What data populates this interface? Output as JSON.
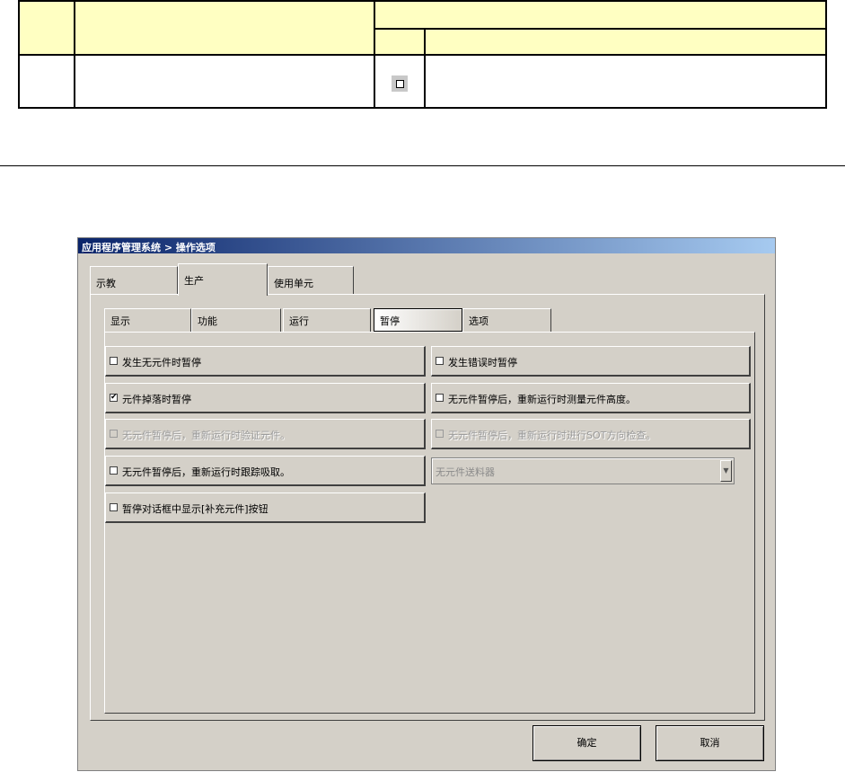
{
  "dialog": {
    "title": "应用程序管理系统 > 操作选项",
    "outer_tabs": [
      {
        "label": "示教",
        "active": false
      },
      {
        "label": "生产",
        "active": true
      },
      {
        "label": "使用单元",
        "active": false
      }
    ],
    "inner_tabs": [
      {
        "label": "显示",
        "active": false
      },
      {
        "label": "功能",
        "active": false
      },
      {
        "label": "运行",
        "active": false
      },
      {
        "label": "暂停",
        "active": true
      },
      {
        "label": "选项",
        "active": false
      }
    ],
    "options": [
      {
        "label": "发生无元件时暂停",
        "checked": false,
        "enabled": true
      },
      {
        "label": "发生错误时暂停",
        "checked": false,
        "enabled": true
      },
      {
        "label": "元件掉落时暂停",
        "checked": true,
        "enabled": true
      },
      {
        "label": "无元件暂停后，重新运行时测量元件高度。",
        "checked": false,
        "enabled": true
      },
      {
        "label": "无元件暂停后，重新运行时验证元件。",
        "checked": false,
        "enabled": false
      },
      {
        "label": "无元件暂停后，重新运行时进行SOT方向检查。",
        "checked": false,
        "enabled": false
      },
      {
        "label": "无元件暂停后，重新运行时跟踪吸取。",
        "checked": false,
        "enabled": true
      },
      {
        "label": "暂停对话框中显示[补充元件]按钮",
        "checked": false,
        "enabled": true
      }
    ],
    "feeder_combo": {
      "value": "无元件送料器",
      "enabled": false
    },
    "ok_label": "确定",
    "cancel_label": "取消"
  },
  "checkmark_glyph": "✔",
  "colors": {
    "highlight": "#ffffc2",
    "titlebar_start": "#0a246a",
    "titlebar_end": "#a6caf0",
    "face": "#d4d0c8"
  }
}
